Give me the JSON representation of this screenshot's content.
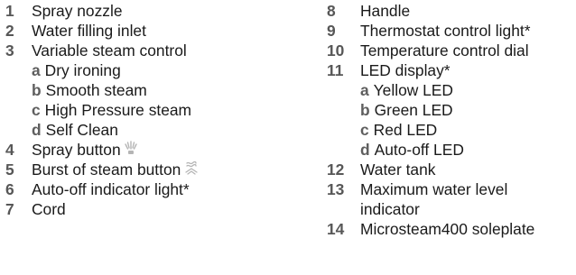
{
  "left_items": [
    {
      "num": "1",
      "label": "Spray nozzle"
    },
    {
      "num": "2",
      "label": "Water filling inlet"
    },
    {
      "num": "3",
      "label": "Variable steam control",
      "sub": [
        {
          "letter": "a",
          "label": "Dry ironing"
        },
        {
          "letter": "b",
          "label": "Smooth steam"
        },
        {
          "letter": "c",
          "label": "High Pressure steam"
        },
        {
          "letter": "d",
          "label": "Self Clean"
        }
      ]
    },
    {
      "num": "4",
      "label": "Spray button",
      "icon": "spray-icon"
    },
    {
      "num": "5",
      "label": "Burst of steam button",
      "icon": "steam-burst-icon"
    },
    {
      "num": "6",
      "label": "Auto-off indicator light*"
    },
    {
      "num": "7",
      "label": "Cord"
    }
  ],
  "right_items": [
    {
      "num": "8",
      "label": "Handle"
    },
    {
      "num": "9",
      "label": "Thermostat control light*"
    },
    {
      "num": "10",
      "label": "Temperature control dial"
    },
    {
      "num": "11",
      "label": "LED display*",
      "sub": [
        {
          "letter": "a",
          "label": "Yellow LED"
        },
        {
          "letter": "b",
          "label": "Green LED"
        },
        {
          "letter": "c",
          "label": "Red LED"
        },
        {
          "letter": "d",
          "label": "Auto-off LED"
        }
      ]
    },
    {
      "num": "12",
      "label": "Water tank"
    },
    {
      "num": "13",
      "label": "Maximum water level",
      "label_cont": "indicator"
    },
    {
      "num": "14",
      "label": "Microsteam400 soleplate"
    }
  ],
  "colors": {
    "text": "#1a1a1a",
    "number": "#575757",
    "icon": "#b5b5b5"
  }
}
